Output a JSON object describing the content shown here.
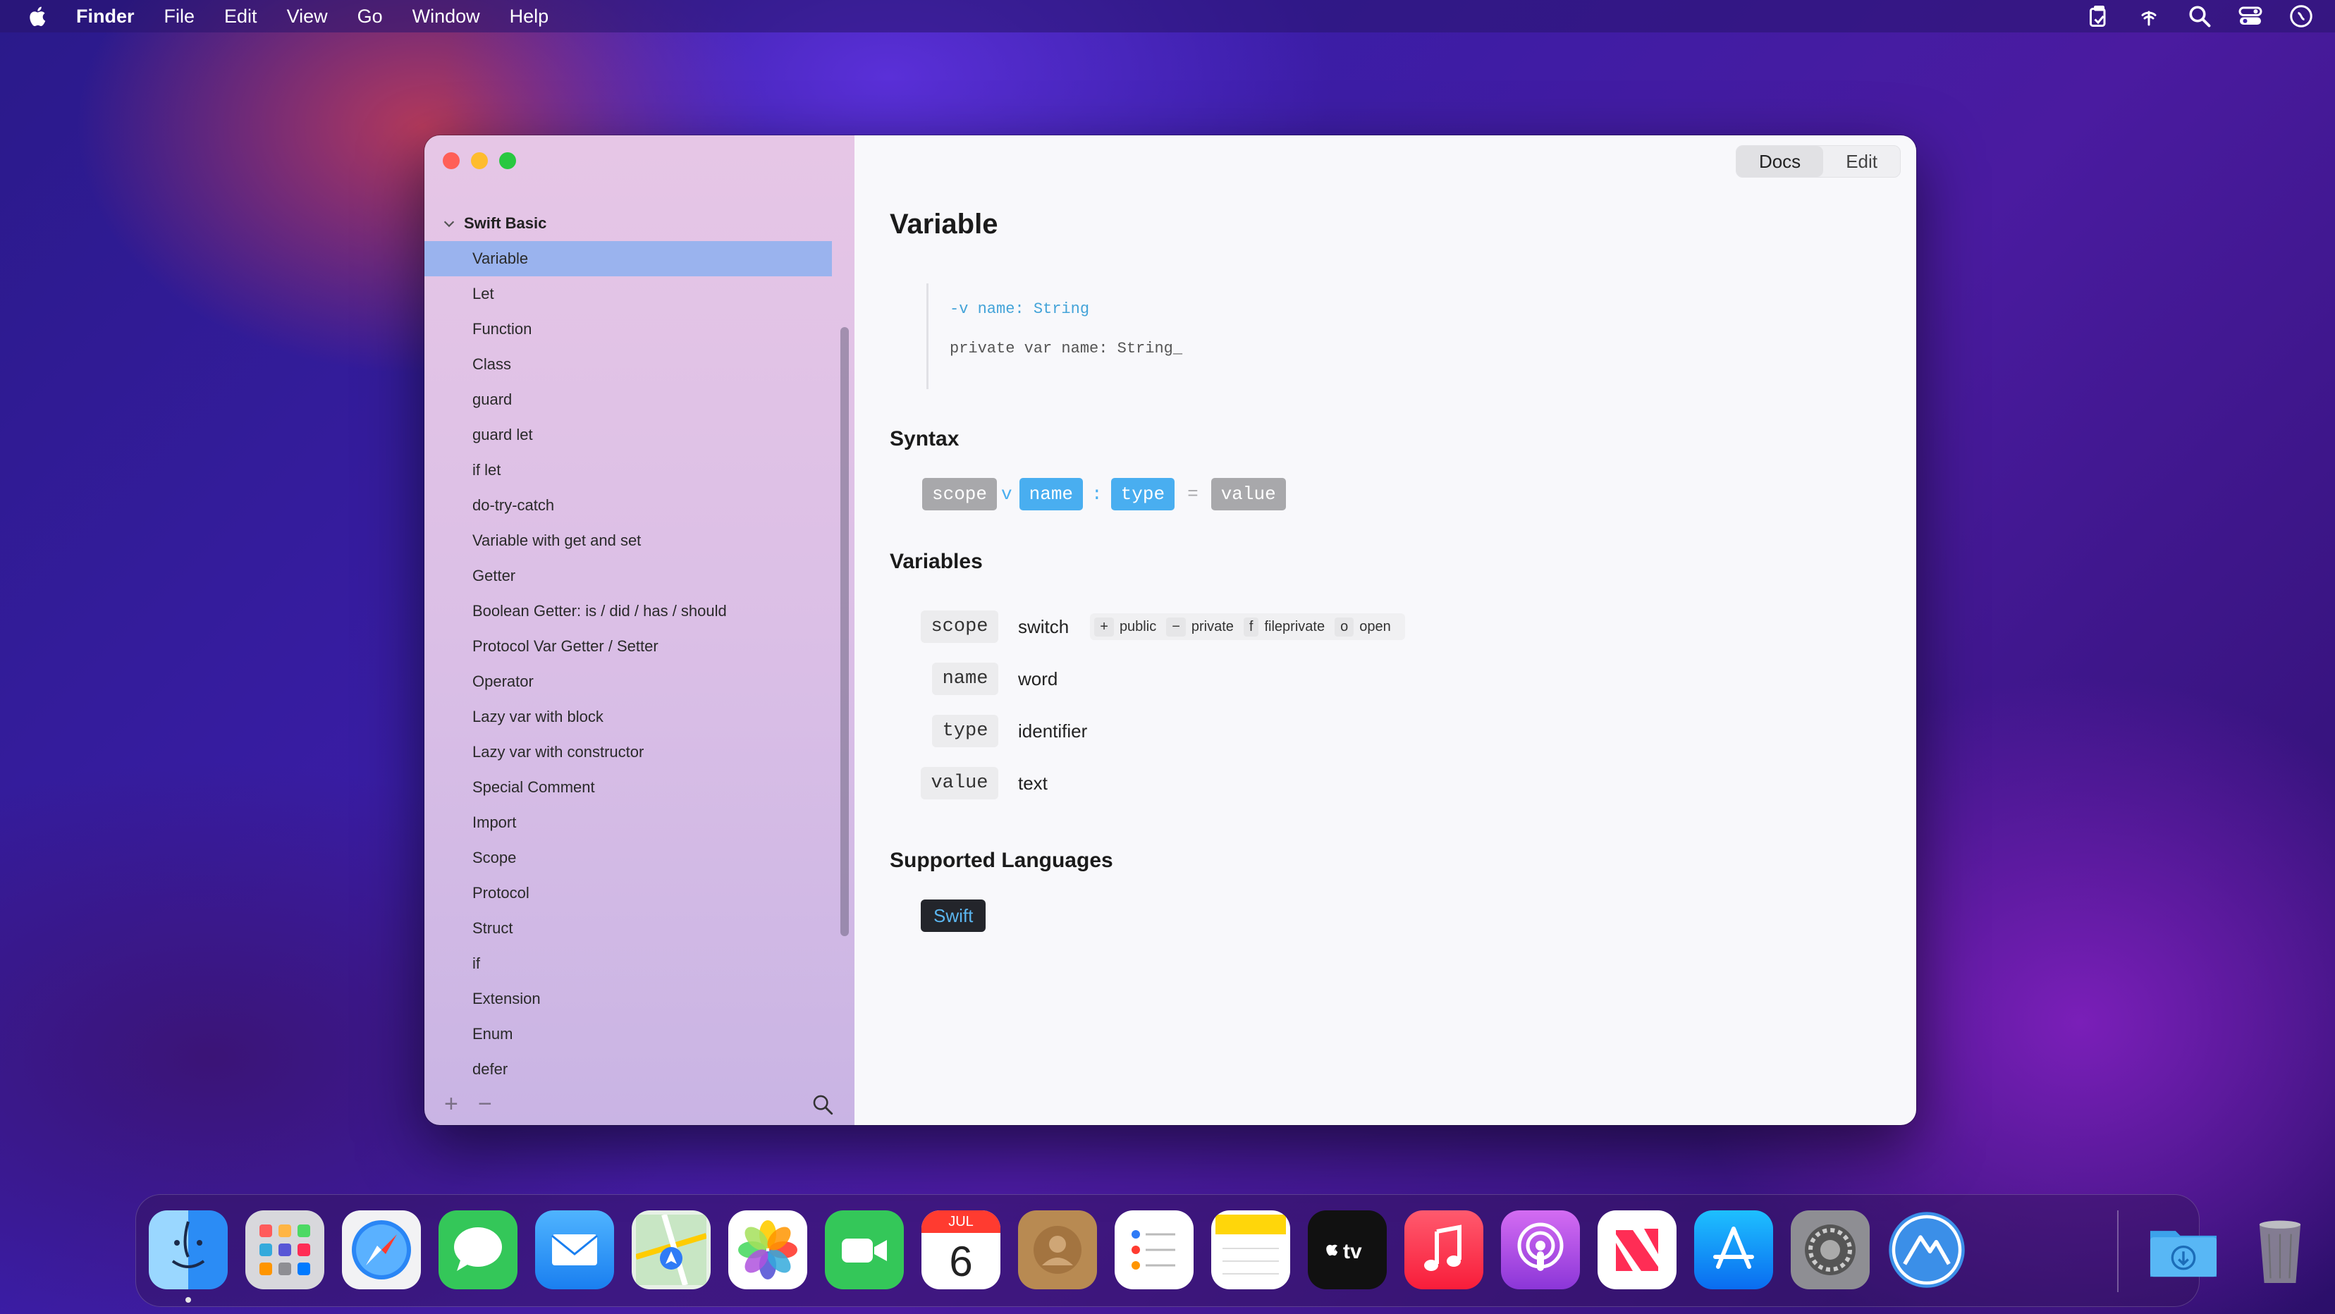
{
  "menubar": {
    "app_name": "Finder",
    "items": [
      "File",
      "Edit",
      "View",
      "Go",
      "Window",
      "Help"
    ],
    "right_icons": [
      "clipboard-icon",
      "wifi-icon",
      "search-icon",
      "control-center-icon",
      "siri-icon"
    ]
  },
  "window": {
    "segmented": {
      "docs": "Docs",
      "edit": "Edit",
      "selected": "Docs"
    }
  },
  "sidebar": {
    "group": "Swift Basic",
    "items": [
      "Variable",
      "Let",
      "Function",
      "Class",
      "guard",
      "guard let",
      "if let",
      "do-try-catch",
      "Variable with get and set",
      "Getter",
      "Boolean Getter: is / did / has / should",
      "Protocol Var Getter / Setter",
      "Operator",
      "Lazy var with block",
      "Lazy var with constructor",
      "Special Comment",
      "Import",
      "Scope",
      "Protocol",
      "Struct",
      "if",
      "Extension",
      "Enum",
      "defer"
    ],
    "selected_index": 0
  },
  "content": {
    "title": "Variable",
    "code": {
      "line1": "-v name: String",
      "line2": "private var name: String_"
    },
    "syntax_heading": "Syntax",
    "syntax": {
      "t1": "scope",
      "s1": "v",
      "t2": "name",
      "s2": ":",
      "t3": "type",
      "s3": "=",
      "t4": "value"
    },
    "variables_heading": "Variables",
    "variables": [
      {
        "key": "scope",
        "value": "switch"
      },
      {
        "key": "name",
        "value": "word"
      },
      {
        "key": "type",
        "value": "identifier"
      },
      {
        "key": "value",
        "value": "text"
      }
    ],
    "scope_options": [
      {
        "sym": "+",
        "label": "public"
      },
      {
        "sym": "−",
        "label": "private"
      },
      {
        "sym": "f",
        "label": "fileprivate"
      },
      {
        "sym": "o",
        "label": "open"
      }
    ],
    "languages_heading": "Supported Languages",
    "languages": [
      "Swift"
    ]
  },
  "dock": {
    "apps": [
      "Finder",
      "Launchpad",
      "Safari",
      "Messages",
      "Mail",
      "Maps",
      "Photos",
      "FaceTime",
      "Calendar",
      "Contacts",
      "Reminders",
      "Notes",
      "TV",
      "Music",
      "Podcasts",
      "News",
      "App Store",
      "System Preferences",
      "Snippet app",
      "Downloads",
      "Trash"
    ],
    "calendar": {
      "month": "JUL",
      "day": "6"
    }
  }
}
